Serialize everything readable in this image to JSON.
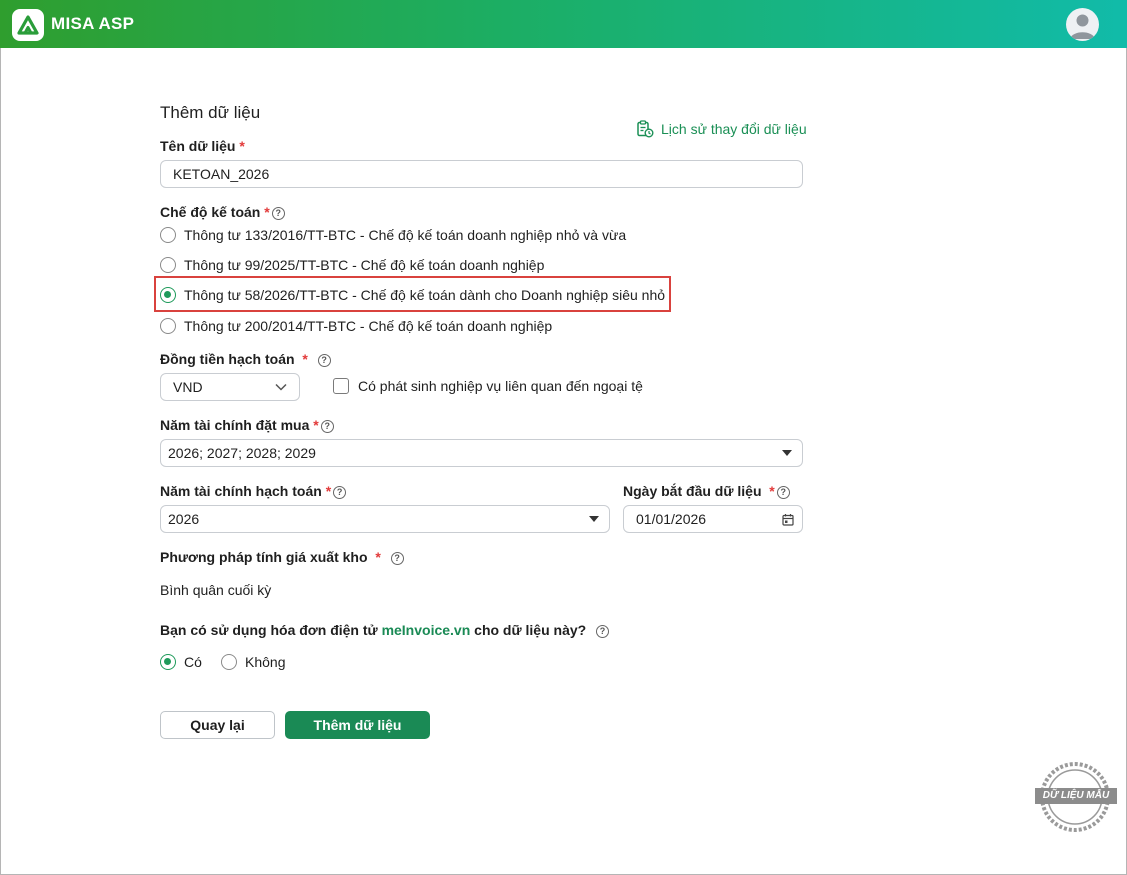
{
  "app": {
    "name": "MISA ASP"
  },
  "form": {
    "title": "Thêm dữ liệu",
    "history_link": "Lịch sử thay đổi dữ liệu",
    "required_mark": "*",
    "help_mark": "?",
    "data_name": {
      "label": "Tên dữ liệu",
      "value": "KETOAN_2026"
    },
    "accounting_regime": {
      "label": "Chế độ kế toán",
      "options": [
        {
          "label": "Thông tư 133/2016/TT-BTC - Chế độ kế toán doanh nghiệp nhỏ và vừa",
          "selected": false
        },
        {
          "label": "Thông tư 99/2025/TT-BTC - Chế độ kế toán doanh nghiệp",
          "selected": false
        },
        {
          "label": "Thông tư 58/2026/TT-BTC - Chế độ kế toán dành cho Doanh nghiệp siêu nhỏ",
          "selected": true
        },
        {
          "label": "Thông tư 200/2014/TT-BTC - Chế độ kế toán doanh nghiệp",
          "selected": false
        }
      ]
    },
    "currency": {
      "label": "Đồng tiền hạch toán",
      "value": "VND",
      "foreign_currency_checkbox": {
        "label": "Có phát sinh nghiệp vụ liên quan đến ngoại tệ",
        "checked": false
      }
    },
    "purchased_fiscal_years": {
      "label": "Năm tài chính đặt mua",
      "value": "2026; 2027; 2028; 2029"
    },
    "accounting_fiscal_year": {
      "label": "Năm tài chính hạch toán",
      "value": "2026"
    },
    "start_date": {
      "label": "Ngày bắt đầu dữ liệu",
      "value": "01/01/2026"
    },
    "inventory_method": {
      "label": "Phương pháp tính giá xuất kho",
      "value": "Bình quân cuối kỳ"
    },
    "einvoice": {
      "label_before": "Bạn có sử dụng hóa đơn điện tử ",
      "link": "meInvoice.vn",
      "label_after": " cho dữ liệu này?",
      "options": [
        {
          "label": "Có",
          "selected": true
        },
        {
          "label": "Không",
          "selected": false
        }
      ]
    },
    "buttons": {
      "back": "Quay lại",
      "submit": "Thêm dữ liệu"
    }
  },
  "watermark": {
    "text": "DỮ LIỆU MẪU"
  },
  "colors": {
    "primary": "#1a8a55",
    "accent_link": "#1a8f55",
    "required": "#e23a3a",
    "highlight_border": "#d9423e"
  }
}
